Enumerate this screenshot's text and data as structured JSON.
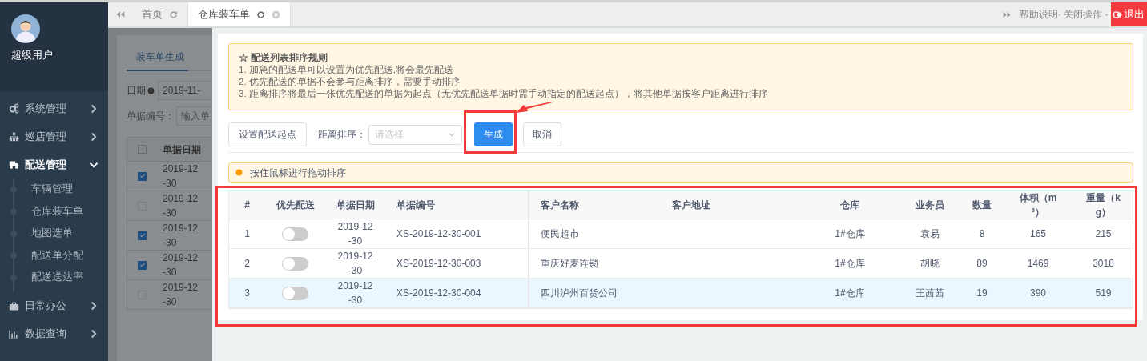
{
  "sidebar": {
    "user": "超级用户",
    "menu": [
      {
        "label": "系统管理",
        "selected": false,
        "expanded": false
      },
      {
        "label": "巡店管理",
        "selected": false,
        "expanded": false
      },
      {
        "label": "配送管理",
        "selected": true,
        "expanded": true,
        "children": [
          {
            "label": "车辆管理"
          },
          {
            "label": "仓库装车单"
          },
          {
            "label": "地图选单"
          },
          {
            "label": "配送单分配"
          },
          {
            "label": "配送送达率"
          }
        ]
      },
      {
        "label": "日常办公",
        "selected": false,
        "expanded": false
      },
      {
        "label": "数据查询",
        "selected": false,
        "expanded": false
      }
    ]
  },
  "tabs": [
    {
      "label": "首页",
      "selected": false,
      "closable": false
    },
    {
      "label": "仓库装车单",
      "selected": true,
      "closable": true
    }
  ],
  "top_right": {
    "help": "帮助说明· 关闭操作",
    "logout": "退出"
  },
  "background_page": {
    "tab": "装车单生成",
    "date_label": "日期",
    "date_value": "2019-11-",
    "number_label": "单据编号：",
    "number_placeholder": "输入单",
    "date_column": "单据日期",
    "header_checked": false,
    "rows": [
      {
        "checked": true,
        "date": "2019-12-30"
      },
      {
        "checked": false,
        "date": "2019-12-30"
      },
      {
        "checked": true,
        "date": "2019-12-30"
      },
      {
        "checked": true,
        "date": "2019-12-30"
      },
      {
        "checked": false,
        "date": "2019-12-30"
      }
    ]
  },
  "panel": {
    "notice": {
      "title": "☆ 配送列表排序规则",
      "lines": [
        "1. 加急的配送单可以设置为优先配送,将会最先配送",
        "2. 优先配送的单据不会参与距离排序，需要手动排序",
        "3. 距离排序将最后一张优先配送的单据为起点（无优先配送单据时需手动指定的配送起点），将其他单据按客户距离进行排序"
      ]
    },
    "set_start_button": "设置配送起点",
    "sort_label": "距离排序：",
    "sort_placeholder": "请选择",
    "generate_button": "生成",
    "cancel_button": "取消",
    "hint": "按住鼠标进行拖动排序",
    "table": {
      "columns": [
        "#",
        "优先配送",
        "单据日期",
        "单据编号",
        "客户名称",
        "客户地址",
        "仓库",
        "业务员",
        "数量",
        "体积（m³）",
        "重量（kg）"
      ],
      "rows": [
        {
          "selected": false,
          "no": "1",
          "priority": false,
          "date": "2019-12-30",
          "code": "XS-2019-12-30-001",
          "customer": "便民超市",
          "warehouse": "1#仓库",
          "salesperson": "袁易",
          "qty": "8",
          "volume": "165",
          "weight": "215"
        },
        {
          "selected": false,
          "no": "2",
          "priority": false,
          "date": "2019-12-30",
          "code": "XS-2019-12-30-003",
          "customer": "重庆好麦连锁",
          "warehouse": "1#仓库",
          "salesperson": "胡晓",
          "qty": "89",
          "volume": "1469",
          "weight": "3018"
        },
        {
          "selected": true,
          "no": "3",
          "priority": false,
          "date": "2019-12-30",
          "code": "XS-2019-12-30-004",
          "customer": "四川泸州百货公司",
          "warehouse": "1#仓库",
          "salesperson": "王茜茜",
          "qty": "19",
          "volume": "390",
          "weight": "519"
        }
      ]
    }
  }
}
